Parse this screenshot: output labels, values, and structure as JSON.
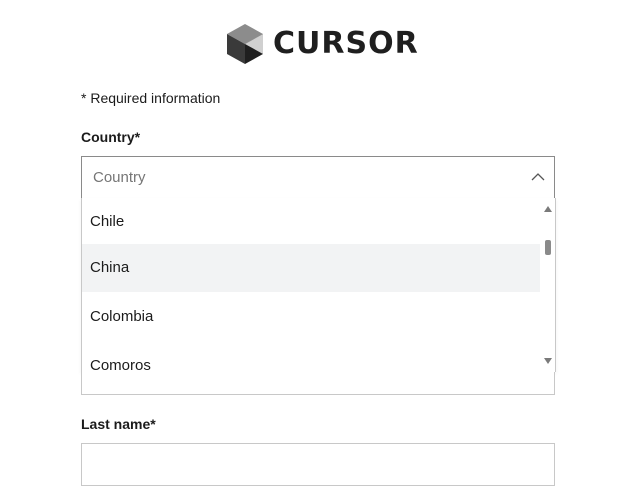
{
  "logo": {
    "text": "CURSOR",
    "icon": "cube-logo-icon"
  },
  "form": {
    "required_note": "* Required information",
    "country": {
      "label": "Country*",
      "placeholder": "Country",
      "options": [
        "Chile",
        "China",
        "Colombia",
        "Comoros"
      ],
      "highlighted_option": "China"
    },
    "last_name": {
      "label": "Last name*",
      "value": ""
    }
  },
  "colors": {
    "border": "#8a8a8a",
    "highlight": "#f2f3f4",
    "text": "#1b1b1b",
    "placeholder": "#767676"
  }
}
